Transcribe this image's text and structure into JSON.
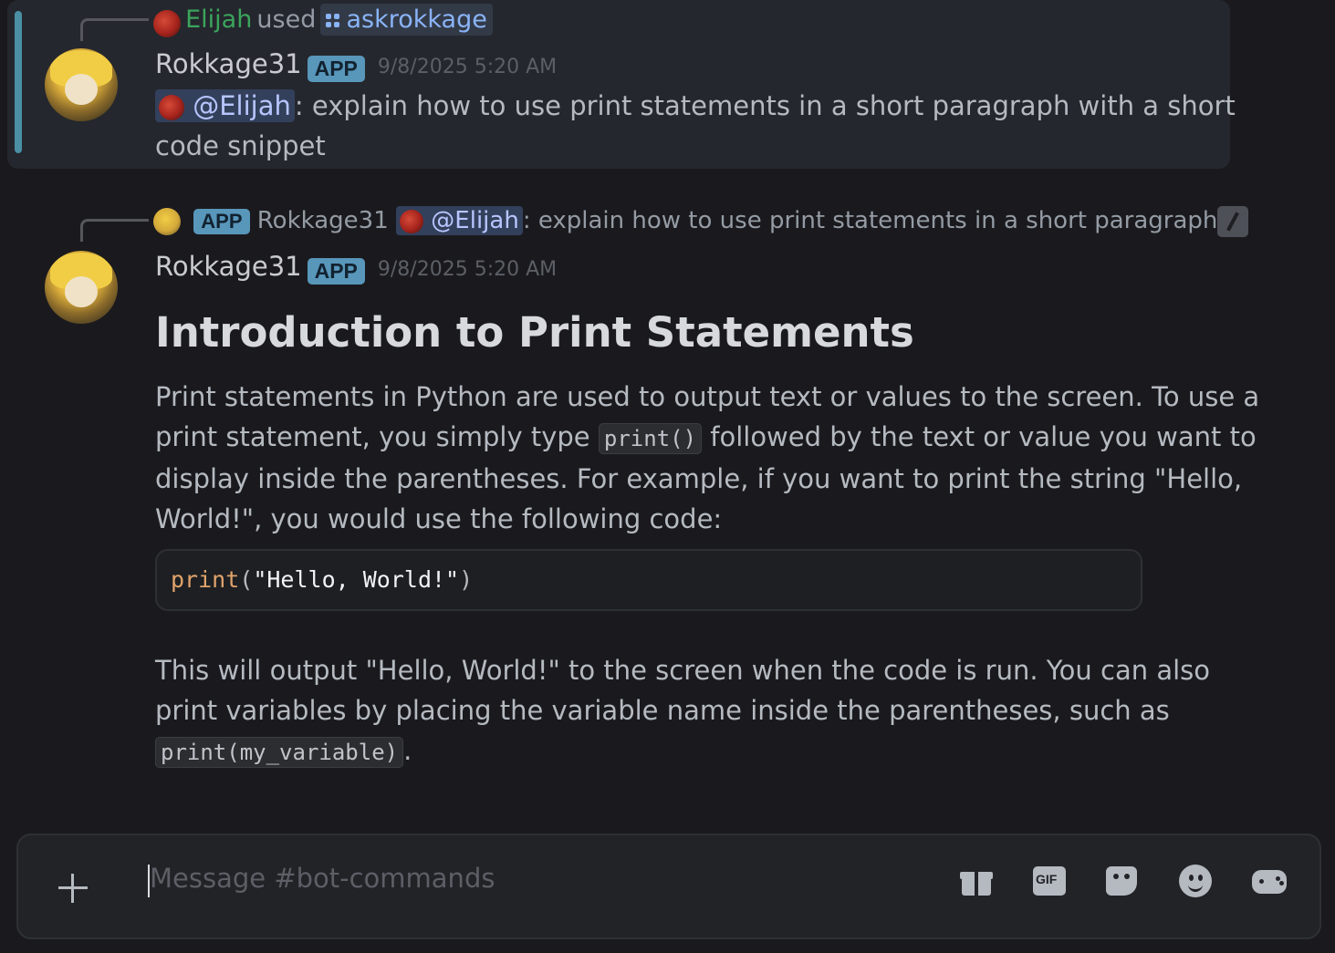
{
  "colors": {
    "background": "#1a1a1e",
    "highlight_bar": "#4a8fa4",
    "command_user": "#3ba55c",
    "app_badge": "#5896ba",
    "mention": "#b7c5ff"
  },
  "message1": {
    "command": {
      "user": "Elijah",
      "used_text": "used",
      "command_name": "askrokkage",
      "icon": "command-icon"
    },
    "author": "Rokkage31",
    "badge": "APP",
    "timestamp": "9/8/2025 5:20 AM",
    "mention": "@Elijah",
    "text_line1": ": explain how to use print statements in a short paragraph with a short",
    "text_line2": "code snippet"
  },
  "message2": {
    "reply": {
      "badge": "APP",
      "author": "Rokkage31",
      "mention": "@Elijah",
      "preview": ": explain how to use print statements in a short paragraph ...",
      "icon": "slash-command-icon"
    },
    "author": "Rokkage31",
    "badge": "APP",
    "timestamp": "9/8/2025 5:20 AM",
    "heading": "Introduction to Print Statements",
    "para1": {
      "line1": "Print statements in Python are used to output text or values to the screen. To use a",
      "line2_pre": "print statement, you simply type ",
      "line2_code": "print()",
      "line2_post": " followed by the text or value you want to",
      "line3": "display inside the parentheses. For example, if you want to print the string \"Hello,",
      "line4": "World!\", you would use the following code:"
    },
    "code": {
      "fn": "print",
      "open": "(",
      "str": "\"Hello, World!\"",
      "close": ")"
    },
    "para2": {
      "line1": "This will output \"Hello, World!\" to the screen when the code is run. You can also",
      "line2": "print variables by placing the variable name inside the parentheses, such as",
      "line3_code": "print(my_variable)",
      "line3_post": "."
    }
  },
  "composer": {
    "placeholder": "Message #bot-commands",
    "icons": [
      "plus-icon",
      "gift-icon",
      "gif-icon",
      "sticker-icon",
      "emoji-icon",
      "gamepad-icon"
    ]
  }
}
